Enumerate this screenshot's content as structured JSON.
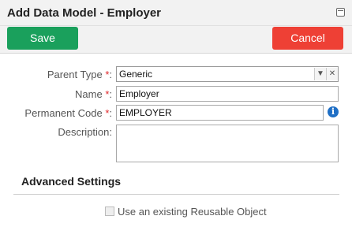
{
  "dialog": {
    "title": "Add Data Model - Employer"
  },
  "toolbar": {
    "save_label": "Save",
    "cancel_label": "Cancel"
  },
  "form": {
    "parent_type": {
      "label": "Parent Type",
      "required_mark": "*",
      "colon": ":",
      "value": "Generic",
      "dropdown_icon": "chevron-down-icon",
      "clear_icon": "close-icon"
    },
    "name": {
      "label": "Name",
      "required_mark": "*",
      "colon": ":",
      "value": "Employer"
    },
    "permanent_code": {
      "label": "Permanent Code",
      "required_mark": "*",
      "colon": ":",
      "value": "EMPLOYER",
      "info_icon": "i"
    },
    "description": {
      "label": "Description:",
      "value": ""
    }
  },
  "advanced": {
    "title": "Advanced Settings",
    "reusable_label": "Use an existing Reusable Object",
    "reusable_checked": false
  },
  "colors": {
    "save": "#1aa05c",
    "cancel": "#ee4035",
    "required": "#e0282b",
    "info": "#1f6fc5"
  }
}
